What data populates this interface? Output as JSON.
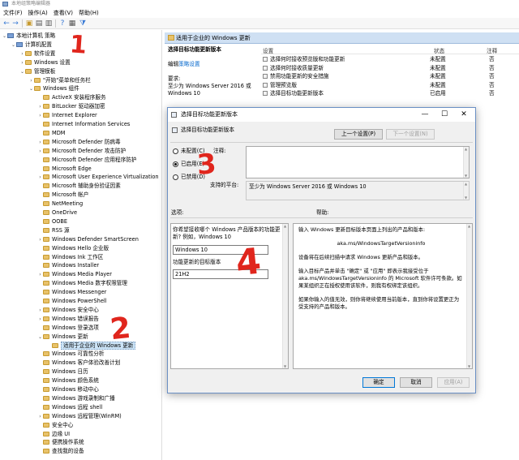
{
  "window": {
    "title": "本地组策略编辑器"
  },
  "menu": [
    "文件(F)",
    "操作(A)",
    "查看(V)",
    "帮助(H)"
  ],
  "toolbar_icons": [
    "back-icon",
    "forward-icon",
    "folder-up-icon",
    "show-hide-tree-icon",
    "export-list-icon",
    "help-icon",
    "properties-icon",
    "filter-icon"
  ],
  "tree": [
    {
      "label": "本地计算机 策略",
      "level": 0,
      "expanded": true,
      "icon": "pc"
    },
    {
      "label": "计算机配置",
      "level": 1,
      "expanded": true,
      "icon": "pc"
    },
    {
      "label": "软件设置",
      "level": 2,
      "expanded": false,
      "icon": "folder"
    },
    {
      "label": "Windows 设置",
      "level": 2,
      "expanded": false,
      "icon": "folder"
    },
    {
      "label": "管理模板",
      "level": 2,
      "expanded": true,
      "icon": "folder"
    },
    {
      "label": "\"开始\"菜单和任务栏",
      "level": 3,
      "expanded": false,
      "icon": "folder"
    },
    {
      "label": "Windows 组件",
      "level": 3,
      "expanded": true,
      "icon": "folder"
    },
    {
      "label": "ActiveX 安装程序服务",
      "level": 4,
      "icon": "folder"
    },
    {
      "label": "BitLocker 驱动器加密",
      "level": 4,
      "expanded": false,
      "icon": "folder"
    },
    {
      "label": "Internet Explorer",
      "level": 4,
      "expanded": false,
      "icon": "folder"
    },
    {
      "label": "Internet Information Services",
      "level": 4,
      "icon": "folder"
    },
    {
      "label": "MDM",
      "level": 4,
      "icon": "folder"
    },
    {
      "label": "Microsoft Defender 防病毒",
      "level": 4,
      "expanded": false,
      "icon": "folder"
    },
    {
      "label": "Microsoft Defender 攻击防护",
      "level": 4,
      "expanded": false,
      "icon": "folder"
    },
    {
      "label": "Microsoft Defender 应用程序防护",
      "level": 4,
      "icon": "folder"
    },
    {
      "label": "Microsoft Edge",
      "level": 4,
      "icon": "folder"
    },
    {
      "label": "Microsoft User Experience Virtualization",
      "level": 4,
      "expanded": false,
      "icon": "folder"
    },
    {
      "label": "Microsoft 辅助身份验证因素",
      "level": 4,
      "icon": "folder"
    },
    {
      "label": "Microsoft 帐户",
      "level": 4,
      "icon": "folder"
    },
    {
      "label": "NetMeeting",
      "level": 4,
      "icon": "folder"
    },
    {
      "label": "OneDrive",
      "level": 4,
      "icon": "folder"
    },
    {
      "label": "OOBE",
      "level": 4,
      "icon": "folder"
    },
    {
      "label": "RSS 源",
      "level": 4,
      "icon": "folder"
    },
    {
      "label": "Windows Defender SmartScreen",
      "level": 4,
      "expanded": false,
      "icon": "folder"
    },
    {
      "label": "Windows Hello 企业版",
      "level": 4,
      "icon": "folder"
    },
    {
      "label": "Windows Ink 工作区",
      "level": 4,
      "icon": "folder"
    },
    {
      "label": "Windows Installer",
      "level": 4,
      "icon": "folder"
    },
    {
      "label": "Windows Media Player",
      "level": 4,
      "expanded": false,
      "icon": "folder"
    },
    {
      "label": "Windows Media 数字权限管理",
      "level": 4,
      "icon": "folder"
    },
    {
      "label": "Windows Messenger",
      "level": 4,
      "icon": "folder"
    },
    {
      "label": "Windows PowerShell",
      "level": 4,
      "icon": "folder"
    },
    {
      "label": "Windows 安全中心",
      "level": 4,
      "expanded": false,
      "icon": "folder"
    },
    {
      "label": "Windows 错误报告",
      "level": 4,
      "expanded": false,
      "icon": "folder"
    },
    {
      "label": "Windows 登录选项",
      "level": 4,
      "icon": "folder"
    },
    {
      "label": "Windows 更新",
      "level": 4,
      "expanded": true,
      "icon": "folder"
    },
    {
      "label": "适用于企业的 Windows 更新",
      "level": 5,
      "icon": "folder",
      "selected": true
    },
    {
      "label": "Windows 可靠性分析",
      "level": 4,
      "icon": "folder"
    },
    {
      "label": "Windows 客户体验改善计划",
      "level": 4,
      "icon": "folder"
    },
    {
      "label": "Windows 日历",
      "level": 4,
      "icon": "folder"
    },
    {
      "label": "Windows 颜色系统",
      "level": 4,
      "icon": "folder"
    },
    {
      "label": "Windows 移动中心",
      "level": 4,
      "icon": "folder"
    },
    {
      "label": "Windows 游戏录制和广播",
      "level": 4,
      "icon": "folder"
    },
    {
      "label": "Windows 远程 shell",
      "level": 4,
      "icon": "folder"
    },
    {
      "label": "Windows 远程管理(WinRM)",
      "level": 4,
      "expanded": false,
      "icon": "folder"
    },
    {
      "label": "安全中心",
      "level": 4,
      "icon": "folder"
    },
    {
      "label": "边缘 UI",
      "level": 4,
      "icon": "folder"
    },
    {
      "label": "便携操作系统",
      "level": 4,
      "icon": "folder"
    },
    {
      "label": "查找我的设备",
      "level": 4,
      "icon": "folder"
    }
  ],
  "right_pane": {
    "header": "适用于企业的 Windows 更新",
    "desc_title": "选择目标功能更新版本",
    "edit_prefix": "编辑",
    "edit_link": "策略设置",
    "req_label": "要求:",
    "req_text": "至少为 Windows Server 2016 或 Windows 10",
    "col_setting": "设置",
    "col_state": "状态",
    "col_comment": "注释",
    "rows": [
      {
        "name": "选择何时接收预览版和功能更新",
        "state": "未配置",
        "comment": "否"
      },
      {
        "name": "选择何时接收质量更新",
        "state": "未配置",
        "comment": "否"
      },
      {
        "name": "禁用功能更新的安全措施",
        "state": "未配置",
        "comment": "否"
      },
      {
        "name": "管理预览版",
        "state": "未配置",
        "comment": "否"
      },
      {
        "name": "选择目标功能更新版本",
        "state": "已启用",
        "comment": "否"
      }
    ]
  },
  "dialog": {
    "title": "选择目标功能更新版本",
    "setting_name": "选择目标功能更新版本",
    "prev_button": "上一个设置(P)",
    "next_button": "下一个设置(N)",
    "radio_not_configured": "未配置(C)",
    "radio_enabled": "已启用(E)",
    "radio_disabled": "已禁用(D)",
    "comment_label": "注释:",
    "platform_label": "支持的平台:",
    "platform_text": "至少为 Windows Server 2016 或 Windows 10",
    "options_label": "选项:",
    "help_label": "帮助:",
    "option_prompt": "你希望接收哪个 Windows 产品版本的功能更新? 例如，Windows 10",
    "product_value": "Windows 10",
    "target_label": "功能更新的目标版本",
    "target_value": "21H2",
    "help_paragraphs": [
      "输入 Windows 更新目标版本页面上列出的产品和版本:",
      "aka.ms/WindowsTargetVersioninfo",
      "设备将在后续扫描中请求 Windows 更新产品和版本。",
      "输入目标产品并单击 \"确定\" 或 \"应用\" 即表示我接受位于 aka.ms/WindowsTargetVersioninfo 的 Microsoft 软件许可条款。如果某组织正在授权使用该软件，则我有权绑定该组织。",
      "如果你输入的值无效，则你将继续使用当前版本，直到你将设置更正为受支持的产品和版本。"
    ],
    "ok_button": "确定",
    "cancel_button": "取消",
    "apply_button": "应用(A)"
  },
  "annotations": [
    "1",
    "2",
    "3",
    "4"
  ],
  "colors": {
    "annotation": "#e0261d",
    "header_bg": "#cfe0f3",
    "selection": "#cce4f7",
    "accent": "#0078d7"
  }
}
